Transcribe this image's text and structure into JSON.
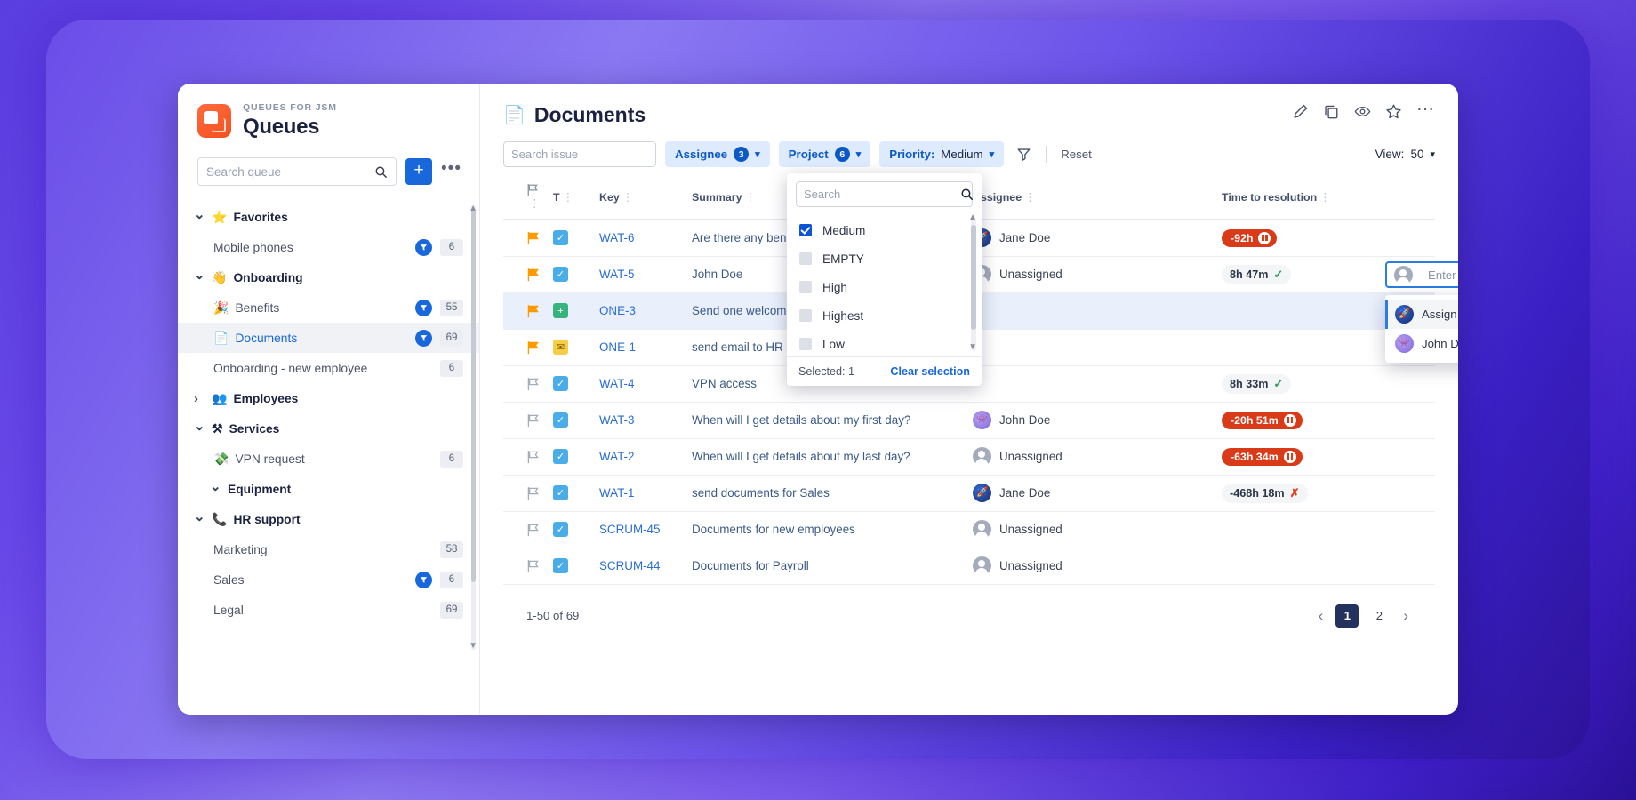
{
  "sidebar": {
    "brand": {
      "eyebrow": "QUEUES FOR JSM",
      "title": "Queues",
      "logo_icon": "queues-app-logo"
    },
    "search": {
      "placeholder": "Search queue",
      "value": "",
      "icon": "search-icon"
    },
    "add_button_label": "+",
    "more_button_label": "•••",
    "items": [
      {
        "label": "Favorites",
        "type": "group",
        "emoji": "⭐",
        "expanded": true
      },
      {
        "label": "Mobile phones",
        "type": "leaf",
        "filter_badge": true,
        "count": "6"
      },
      {
        "label": "Onboarding",
        "type": "group",
        "emoji": "👋",
        "expanded": true
      },
      {
        "label": "Benefits",
        "type": "leaf",
        "emoji": "🎉",
        "filter_badge": true,
        "count": "55"
      },
      {
        "label": "Documents",
        "type": "leaf",
        "emoji": "📄",
        "filter_badge": true,
        "count": "69",
        "active": true
      },
      {
        "label": "Onboarding - new employee",
        "type": "leaf",
        "filter_badge": false,
        "count": "6"
      },
      {
        "label": "Employees",
        "type": "group",
        "emoji": "👥",
        "expanded": false
      },
      {
        "label": "Services",
        "type": "group",
        "emoji": "⚒",
        "expanded": true
      },
      {
        "label": "VPN request",
        "type": "leaf",
        "emoji": "💸",
        "filter_badge": false,
        "count": "6"
      },
      {
        "label": "Equipment",
        "type": "subgroup",
        "expanded": true
      },
      {
        "label": "HR support",
        "type": "group",
        "emoji": "📞",
        "expanded": true
      },
      {
        "label": "Marketing",
        "type": "leaf",
        "filter_badge": false,
        "count": "58"
      },
      {
        "label": "Sales",
        "type": "leaf",
        "filter_badge": true,
        "count": "6"
      },
      {
        "label": "Legal",
        "type": "leaf",
        "filter_badge": false,
        "count": "69"
      }
    ]
  },
  "header": {
    "title": "Documents",
    "title_icon": "document-icon",
    "actions": [
      "edit-icon",
      "copy-icon",
      "watch-icon",
      "star-icon",
      "more-icon"
    ]
  },
  "toolbar": {
    "search": {
      "placeholder": "Search issue",
      "value": ""
    },
    "filters": [
      {
        "name": "Assignee",
        "count": "3"
      },
      {
        "name": "Project",
        "count": "6"
      }
    ],
    "priority_filter": {
      "name": "Priority:",
      "value": "Medium"
    },
    "filter_icon": "funnel-icon",
    "reset_label": "Reset",
    "view_label": "View:",
    "view_value": "50"
  },
  "priority_dropdown": {
    "search_placeholder": "Search",
    "options": [
      {
        "label": "Medium",
        "checked": true
      },
      {
        "label": "EMPTY",
        "checked": false
      },
      {
        "label": "High",
        "checked": false
      },
      {
        "label": "Highest",
        "checked": false
      },
      {
        "label": "Low",
        "checked": false
      }
    ],
    "selected_text": "Selected: 1",
    "clear_label": "Clear selection"
  },
  "assignee_editor": {
    "placeholder": "Enter people",
    "options": [
      {
        "label": "Assign to me",
        "avatar": "jane",
        "highlighted": true
      },
      {
        "label": "John Doe",
        "avatar": "john",
        "highlighted": false
      }
    ]
  },
  "table": {
    "columns": [
      "",
      "T",
      "Key",
      "Summary",
      "Assignee",
      "Time to resolution"
    ],
    "rows": [
      {
        "flag": true,
        "type": "task",
        "key": "WAT-6",
        "summary": "Are there any benefits available fo",
        "assignee": "Jane Doe",
        "avatar": "jane",
        "sla": "-92h",
        "sla_state": "breached"
      },
      {
        "flag": true,
        "type": "task",
        "key": "WAT-5",
        "summary": "John Doe",
        "assignee": "Unassigned",
        "avatar": "none",
        "sla": "8h 47m",
        "sla_state": "ok"
      },
      {
        "flag": true,
        "type": "new",
        "key": "ONE-3",
        "summary": "Send one welcome gift",
        "assignee": "",
        "avatar": "none",
        "sla": "",
        "sla_state": "none",
        "selected": true
      },
      {
        "flag": true,
        "type": "mail",
        "key": "ONE-1",
        "summary": "send email to HR so they upload",
        "assignee": "",
        "avatar": "none",
        "sla": "",
        "sla_state": "none"
      },
      {
        "flag": false,
        "type": "task",
        "key": "WAT-4",
        "summary": "VPN access",
        "assignee": "",
        "avatar": "none",
        "sla": "8h 33m",
        "sla_state": "ok"
      },
      {
        "flag": false,
        "type": "task",
        "key": "WAT-3",
        "summary": "When will I get details about my first day?",
        "assignee": "John Doe",
        "avatar": "john",
        "sla": "-20h 51m",
        "sla_state": "breached"
      },
      {
        "flag": false,
        "type": "task",
        "key": "WAT-2",
        "summary": "When will I get details about my last day?",
        "assignee": "Unassigned",
        "avatar": "none",
        "sla": "-63h 34m",
        "sla_state": "breached"
      },
      {
        "flag": false,
        "type": "task",
        "key": "WAT-1",
        "summary": "send documents for Sales",
        "assignee": "Jane Doe",
        "avatar": "jane",
        "sla": "-468h 18m",
        "sla_state": "failed"
      },
      {
        "flag": false,
        "type": "task",
        "key": "SCRUM-45",
        "summary": "Documents for new employees",
        "assignee": "Unassigned",
        "avatar": "none",
        "sla": "",
        "sla_state": "none"
      },
      {
        "flag": false,
        "type": "task",
        "key": "SCRUM-44",
        "summary": "Documents for Payroll",
        "assignee": "Unassigned",
        "avatar": "none",
        "sla": "",
        "sla_state": "none"
      }
    ]
  },
  "footer": {
    "count_text": "1-50 of 69",
    "pages": [
      "1",
      "2"
    ],
    "current_page": "1",
    "prev_icon": "chevron-left-icon",
    "next_icon": "chevron-right-icon"
  },
  "colors": {
    "accent": "#1868db",
    "pill_bg": "#deebff",
    "sla_red": "#d93a18",
    "sla_green": "#2e9b5d",
    "brand_orange": "#f4511e"
  }
}
